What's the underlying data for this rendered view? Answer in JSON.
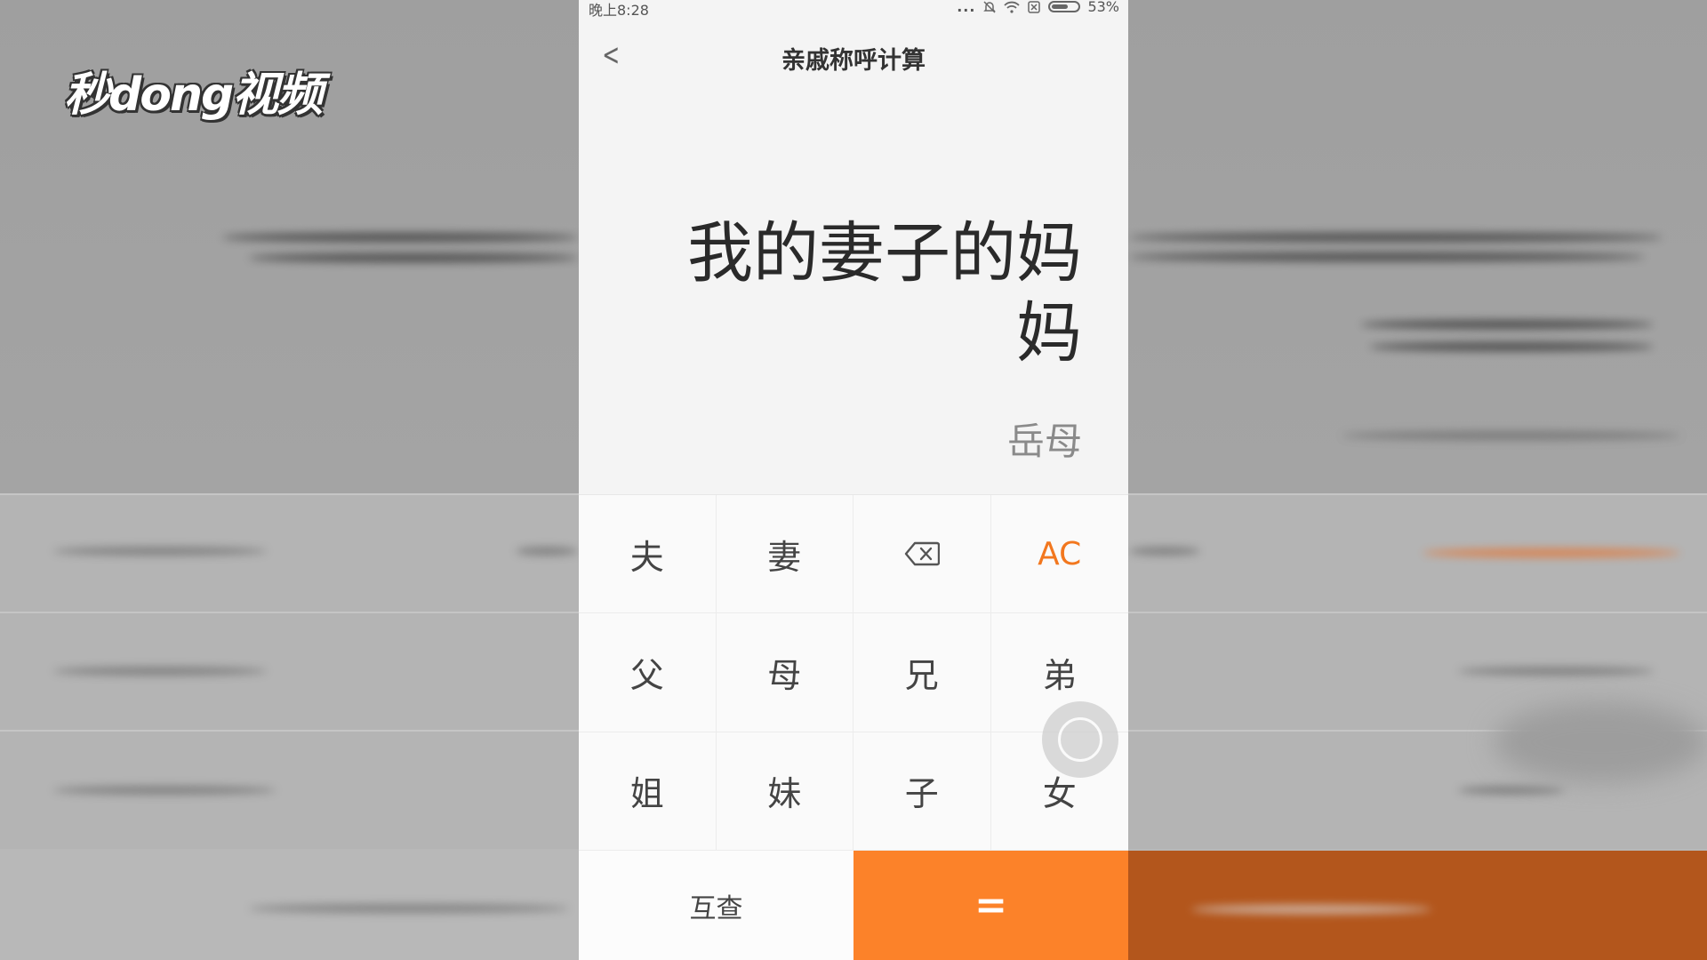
{
  "logo": {
    "text": "秒dong视频"
  },
  "statusbar": {
    "time": "晚上8:28",
    "dots": "...",
    "battery": "53%"
  },
  "header": {
    "back_icon": "chevron-left-icon",
    "title": "亲戚称呼计算"
  },
  "display": {
    "expression": "我的妻子的妈妈",
    "result": "岳母"
  },
  "keypad": {
    "keys": [
      {
        "label": "夫",
        "name": "key-husband"
      },
      {
        "label": "妻",
        "name": "key-wife"
      },
      {
        "label": "",
        "name": "backspace-button",
        "icon": "backspace-icon"
      },
      {
        "label": "AC",
        "name": "clear-all-button"
      },
      {
        "label": "父",
        "name": "key-father"
      },
      {
        "label": "母",
        "name": "key-mother"
      },
      {
        "label": "兄",
        "name": "key-elder-brother"
      },
      {
        "label": "弟",
        "name": "key-younger-brother"
      },
      {
        "label": "姐",
        "name": "key-elder-sister"
      },
      {
        "label": "妹",
        "name": "key-younger-sister"
      },
      {
        "label": "子",
        "name": "key-son"
      },
      {
        "label": "女",
        "name": "key-daughter"
      }
    ]
  },
  "bottom": {
    "mutual_label": "互查",
    "equals_label": "="
  },
  "colors": {
    "accent": "#fc8229",
    "ac_text": "#f2771e"
  }
}
